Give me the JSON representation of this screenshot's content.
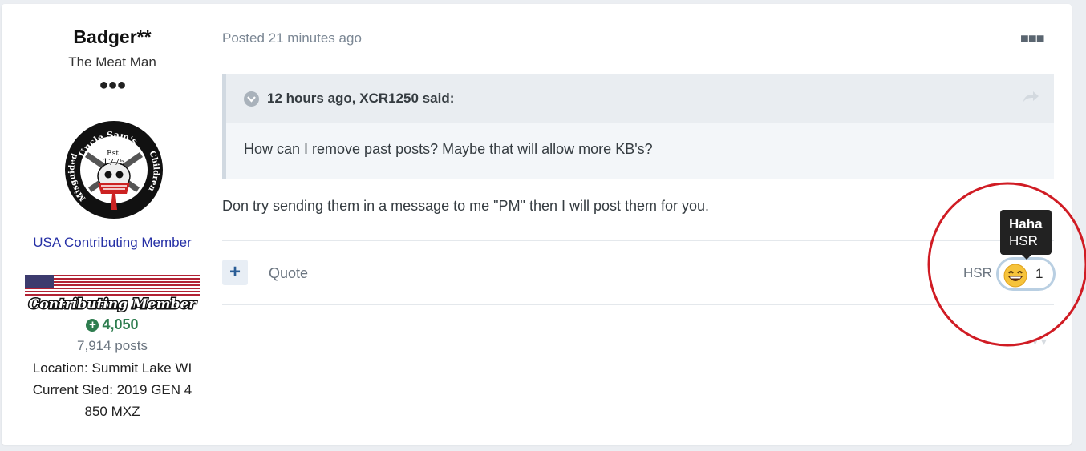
{
  "author": {
    "name": "Badger**",
    "title": "The Meat Man",
    "rank_dots": "●●●",
    "avatar_text_top": "Uncle Sam's",
    "avatar_text_left": "Misguided",
    "avatar_text_right": "Children",
    "avatar_est": "Est.",
    "avatar_year": "1775",
    "group": "USA Contributing Member",
    "badge_text": "Contributing Member",
    "reputation": "4,050",
    "posts": "7,914 posts",
    "location": "Location: Summit Lake WI",
    "sled": "Current Sled: 2019 GEN 4 850 MXZ"
  },
  "post": {
    "posted": "Posted 21 minutes ago",
    "menu_icon": "ellipsis-icon",
    "quote": {
      "citation": "12 hours ago, XCR1250 said:",
      "text": "How can I remove past posts? Maybe that will allow more KB's?"
    },
    "body": "Don try sending them in a message to me \"PM\" then I will post them for you."
  },
  "actions": {
    "plus_label": "+",
    "quote_label": "Quote",
    "reaction_user": "HSR",
    "reaction_count": "1",
    "tooltip_title": "Haha",
    "tooltip_user": "HSR"
  },
  "colors": {
    "reputation": "#2e7d4f",
    "group": "#2630a6",
    "annotation_circle": "#d01c24"
  }
}
